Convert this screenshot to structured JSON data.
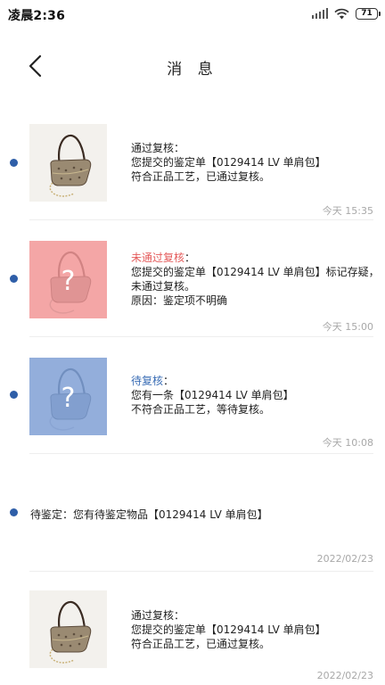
{
  "status_bar": {
    "time": "凌晨2:36",
    "battery": "71"
  },
  "header": {
    "title": "消 息"
  },
  "messages": [
    {
      "status": "通过复核",
      "colon": "：",
      "line1": "您提交的鉴定单【0129414 LV 单肩包】",
      "line2": "符合正品工艺，已通过复核。",
      "line3": "",
      "time": "今天 15:35"
    },
    {
      "status": "未通过复核",
      "colon": "：",
      "line1": "您提交的鉴定单【0129414 LV 单肩包】标记存疑，",
      "line2": "未通过复核。",
      "line3": "原因：鉴定项不明确",
      "time": "今天 15:00"
    },
    {
      "status": "待复核",
      "colon": "：",
      "line1": "您有一条【0129414 LV 单肩包】",
      "line2": "不符合正品工艺，等待复核。",
      "line3": "",
      "time": "今天 10:08"
    },
    {
      "text": "待鉴定：您有待鉴定物品【0129414 LV 单肩包】",
      "time": "2022/02/23"
    },
    {
      "status": "通过复核",
      "colon": "：",
      "line1": "您提交的鉴定单【0129414 LV 单肩包】",
      "line2": "符合正品工艺，已通过复核。",
      "line3": "",
      "time": "2022/02/23"
    }
  ],
  "colors": {
    "accent_dot": "#2e5ea8",
    "rejected": "#e45b5b",
    "pending": "#3a6db5",
    "rejected_thumb": "#f4a6a6",
    "pending_thumb": "#93aedb"
  },
  "icons": {
    "back": "chevron-left-icon",
    "question": "question-mark-icon",
    "bag": "shoulder-bag-icon"
  }
}
